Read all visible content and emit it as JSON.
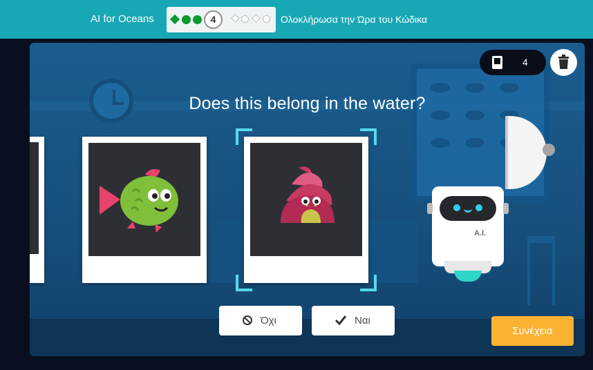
{
  "header": {
    "course_title": "AI for Oceans",
    "progress": {
      "completed_levels": 3,
      "current_level": "4",
      "remaining_levels": 4
    },
    "finish_link": "Ολοκλήρωσα την Ώρα του Κώδικα"
  },
  "scene": {
    "question": "Does this belong in the water?",
    "counter_value": "4",
    "robot_label": "A.I."
  },
  "cards": [
    {
      "name": "fish",
      "state": "previous"
    },
    {
      "name": "hermit-crab-shell",
      "state": "current"
    }
  ],
  "buttons": {
    "no_label": "Όχι",
    "yes_label": "Ναι",
    "continue_label": "Συνέχεια"
  },
  "icons": {
    "no": "ban-icon",
    "yes": "check-icon",
    "counter": "card-stack-icon",
    "trash": "trash-icon"
  },
  "colors": {
    "header": "#18a8b5",
    "progress_done": "#0a9b2e",
    "continue": "#fbb232",
    "accent": "#56d8ea"
  }
}
